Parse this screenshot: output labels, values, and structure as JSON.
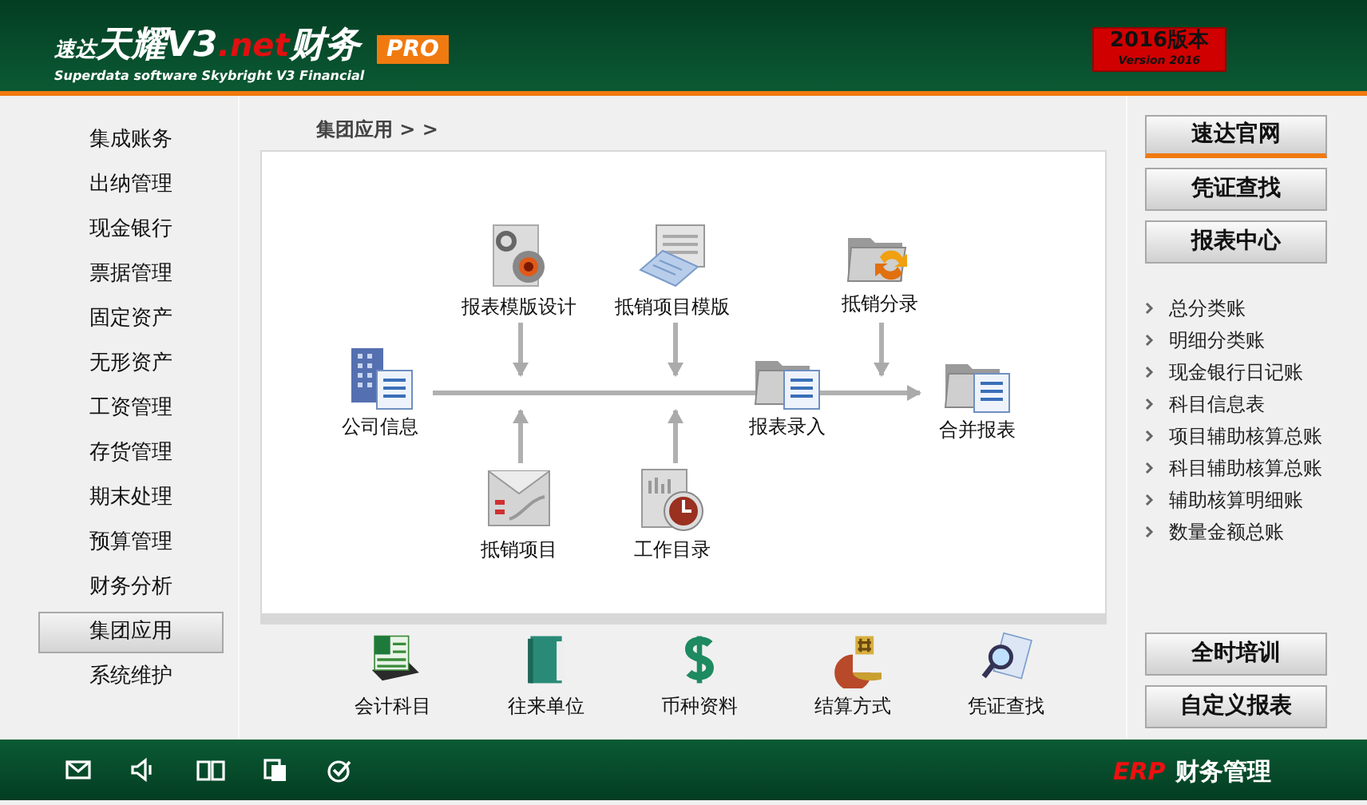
{
  "header": {
    "brand_small": "速达",
    "brand_main": "天耀V3",
    "brand_net": ".net",
    "brand_suffix": "财务",
    "subtitle": "Superdata software Skybright V3 Financial",
    "edition": "PRO",
    "version_title": "2016版本",
    "version_subtitle": "Version 2016"
  },
  "sidebar": {
    "items": [
      {
        "label": "集成账务",
        "selected": false
      },
      {
        "label": "出纳管理",
        "selected": false
      },
      {
        "label": "现金银行",
        "selected": false
      },
      {
        "label": "票据管理",
        "selected": false
      },
      {
        "label": "固定资产",
        "selected": false
      },
      {
        "label": "无形资产",
        "selected": false
      },
      {
        "label": "工资管理",
        "selected": false
      },
      {
        "label": "存货管理",
        "selected": false
      },
      {
        "label": "期末处理",
        "selected": false
      },
      {
        "label": "预算管理",
        "selected": false
      },
      {
        "label": "财务分析",
        "selected": false
      },
      {
        "label": "集团应用",
        "selected": true
      },
      {
        "label": "系统维护",
        "selected": false
      }
    ]
  },
  "breadcrumb": "集团应用 > >",
  "diagram": {
    "nodes": [
      {
        "label": "公司信息"
      },
      {
        "label": "报表模版设计"
      },
      {
        "label": "抵销项目模版"
      },
      {
        "label": "抵销分录"
      },
      {
        "label": "报表录入"
      },
      {
        "label": "合并报表"
      },
      {
        "label": "抵销项目"
      },
      {
        "label": "工作目录"
      }
    ]
  },
  "shortcuts": [
    {
      "label": "会计科目"
    },
    {
      "label": "往来单位"
    },
    {
      "label": "币种资料"
    },
    {
      "label": "结算方式"
    },
    {
      "label": "凭证查找"
    }
  ],
  "right_buttons_top": [
    {
      "label": "速达官网",
      "selected": true
    },
    {
      "label": "凭证查找",
      "selected": false
    },
    {
      "label": "报表中心",
      "selected": false
    }
  ],
  "report_links": [
    "总分类账",
    "明细分类账",
    "现金银行日记账",
    "科目信息表",
    "项目辅助核算总账",
    "科目辅助核算总账",
    "辅助核算明细账",
    "数量金额总账"
  ],
  "right_buttons_bottom": [
    {
      "label": "全时培训",
      "selected": false
    },
    {
      "label": "自定义报表",
      "selected": false
    }
  ],
  "footer": {
    "erp": "ERP",
    "title": "财务管理"
  }
}
